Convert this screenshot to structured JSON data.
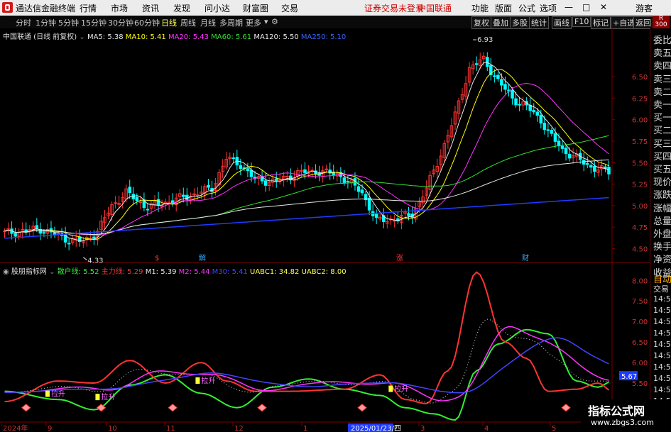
{
  "titlebar": {
    "app_name": "通达信金融终端",
    "menu": [
      "行情",
      "市场",
      "资讯",
      "发现",
      "问小达",
      "财富圈",
      "交易"
    ],
    "status": "证券交易未登录",
    "stock_name": "中国联通",
    "right_menu": [
      "功能",
      "版面",
      "公式",
      "选项"
    ],
    "user": "游客",
    "window_controls": [
      "—",
      "□",
      "✕"
    ]
  },
  "toolbar": {
    "periods": [
      "分时",
      "1分钟",
      "5分钟",
      "15分钟",
      "30分钟",
      "60分钟",
      "日线",
      "周线",
      "月线",
      "多周期",
      "更多"
    ],
    "active_period": "日线",
    "right_buttons": [
      "复权",
      "叠加",
      "多股",
      "统计",
      "画线",
      "F10",
      "标记",
      "+自选",
      "返回"
    ]
  },
  "right_panel": {
    "badge": "R",
    "badge_num": "300",
    "items": [
      "委比",
      "卖五",
      "卖四",
      "卖三",
      "卖二",
      "卖一",
      "买一",
      "买二",
      "买三",
      "买四",
      "买五",
      "现价",
      "涨跌",
      "涨幅",
      "总量",
      "外盘",
      "换手",
      "净资",
      "收益"
    ],
    "bottom_items": [
      "自动",
      "交易",
      "14:56",
      "14:56",
      "14:56",
      "14:56",
      "14:56",
      "14:56",
      "14:56",
      "14:56",
      "14:56",
      "14:56"
    ]
  },
  "main_legend": {
    "title": "中国联通 (日线 前复权)",
    "items": [
      {
        "label": "MA5: 5.38",
        "color": "#e8e8e8"
      },
      {
        "label": "MA10: 5.41",
        "color": "#ffff00"
      },
      {
        "label": "MA20: 5.43",
        "color": "#ff33ff"
      },
      {
        "label": "MA60: 5.61",
        "color": "#33dd33"
      },
      {
        "label": "MA120: 5.50",
        "color": "#e8e8e8"
      },
      {
        "label": "MA250: 5.10",
        "color": "#3366ff"
      }
    ]
  },
  "main_axis": {
    "ticks": [
      "6.50",
      "6.25",
      "6.00",
      "5.75",
      "5.50",
      "5.25",
      "5.00",
      "4.75",
      "4.50"
    ],
    "high_label": "6.93",
    "low_label": "4.33",
    "markers": [
      "$",
      "解",
      "涨",
      "财"
    ]
  },
  "indicator_legend": {
    "title": "股朋指标网",
    "items": [
      {
        "label": "散户线: 5.52",
        "color": "#33ee33"
      },
      {
        "label": "主力线: 5.29",
        "color": "#ff3333"
      },
      {
        "label": "M1: 5.39",
        "color": "#e8e8e8"
      },
      {
        "label": "M2: 5.44",
        "color": "#ff33ff"
      },
      {
        "label": "M30: 5.41",
        "color": "#4444ff"
      },
      {
        "label": "UABC1: 34.82",
        "color": "#ffff55"
      },
      {
        "label": "UABC2: 8.00",
        "color": "#ffff55"
      }
    ]
  },
  "indicator_axis": {
    "ticks": [
      "8.00",
      "7.50",
      "7.00",
      "6.50",
      "6.00",
      "5.50",
      "5.00"
    ],
    "current_value": "5.67",
    "signal_labels": [
      "拉升",
      "拉升",
      "拉升",
      "拉升"
    ]
  },
  "date_axis": {
    "labels": [
      "2024年",
      "9",
      "10",
      "11",
      "12",
      "1",
      "2025/01/23/四",
      "3",
      "4",
      "5"
    ]
  },
  "watermark": {
    "line1": "指标公式网",
    "line2": "www.zbgs3.com"
  },
  "colors": {
    "up": "#ff3333",
    "down": "#00ffff",
    "frame": "#7a0000",
    "ma250": "#1e3cff"
  }
}
